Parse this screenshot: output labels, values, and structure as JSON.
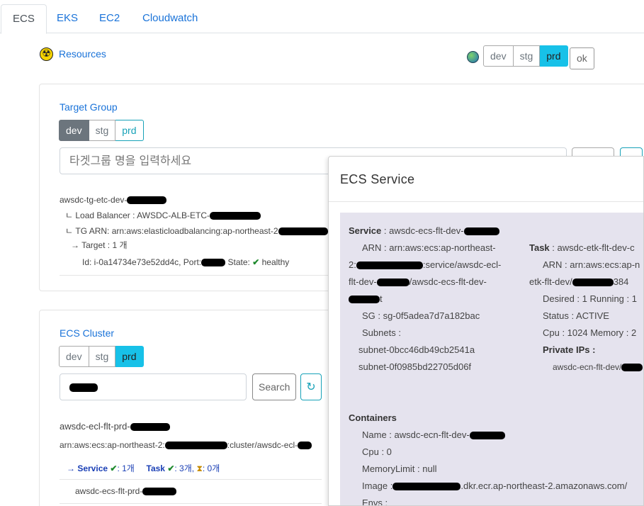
{
  "tabs": [
    "ECS",
    "EKS",
    "EC2",
    "Cloudwatch"
  ],
  "resources_label": "Resources",
  "env_selector": {
    "options": [
      "dev",
      "stg",
      "prd"
    ],
    "selected": "prd",
    "ok_label": "ok"
  },
  "target_group": {
    "title": "Target Group",
    "env_options": [
      "dev",
      "stg",
      "prd"
    ],
    "selected": "dev",
    "search_placeholder": "타겟그룹 명을 입력하세요",
    "result": {
      "name": "awsdc-tg-etc-dev-",
      "load_balancer": "ㄴ Load Balancer : AWSDC-ALB-ETC-",
      "tg_arn": "ㄴ TG ARN: arn:aws:elasticloadbalancing:ap-northeast-2",
      "target": "→ Target : 1 개",
      "target_id": "Id: i-0a14734e73e52dd4c, Port:",
      "state_label": "State:",
      "state_value": "healthy"
    }
  },
  "ecs_cluster": {
    "title": "ECS Cluster",
    "env_options": [
      "dev",
      "stg",
      "prd"
    ],
    "selected": "prd",
    "search_button": "Search",
    "refresh_icon": "↻",
    "result": {
      "name": "awsdc-ecl-flt-prd-",
      "arn_prefix": "arn:aws:ecs:ap-northeast-2:",
      "arn_suffix": ":cluster/awsdc-ecl-",
      "service_label": "→ Service",
      "service_count": ": 1개",
      "task_label": "Task",
      "task_count": ": 3개,",
      "pending_count": ": 0개",
      "service_item": "awsdc-ecs-flt-prd-"
    }
  },
  "modal": {
    "title": "ECS Service",
    "service": {
      "label": "Service",
      "name": ": awsdc-ecs-flt-dev-",
      "arn_line1": "ARN : arn:aws:ecs:ap-northeast-",
      "arn_line2_pre": "2:",
      "arn_line2_post": ":service/awsdc-ecl-",
      "arn_line3_pre": "flt-dev-",
      "arn_line3_post": "/awsdc-ecs-flt-dev-",
      "arn_line4_post": "t",
      "sg": "SG : sg-0f5adea7d7a182bac",
      "subnets_label": "Subnets :",
      "subnet1": "subnet-0bcc46db49cb2541a",
      "subnet2": "subnet-0f0985bd22705d06f"
    },
    "task": {
      "label": "Task",
      "name": ": awsdc-etk-flt-dev-c",
      "arn_line1": "ARN : arn:aws:ecs:ap-n",
      "arn_line2_pre": "etk-flt-dev/",
      "arn_line2_post": "384",
      "desired": "Desired : 1 Running : 1",
      "status": "Status : ACTIVE",
      "cpu": "Cpu : 1024 Memory : 2",
      "private_ips_label": "Private IPs :",
      "private_ip": "awsdc-ecn-flt-dev/"
    },
    "containers": {
      "label": "Containers",
      "name": "Name : awsdc-ecn-flt-dev-",
      "cpu": "Cpu : 0",
      "memory": "MemoryLimit : null",
      "image_pre": "Image :",
      "image_post": ".dkr.ecr.ap-northeast-2.amazonaws.com/",
      "envs": "Envs :"
    }
  }
}
